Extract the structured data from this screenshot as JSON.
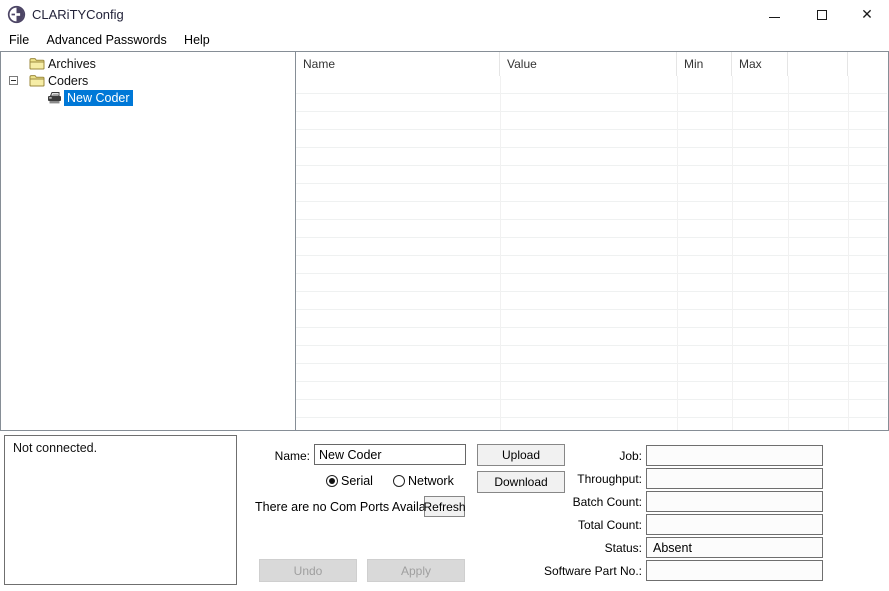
{
  "window": {
    "title": "CLARiTYConfig",
    "controls": {
      "minimize": "minimize",
      "maximize": "maximize",
      "close": "close"
    }
  },
  "icons": {
    "maximize_glyph": "",
    "close_glyph": "✕"
  },
  "menu": {
    "items": [
      {
        "label": "File"
      },
      {
        "label": "Advanced Passwords"
      },
      {
        "label": "Help"
      }
    ]
  },
  "tree": {
    "items": [
      {
        "label": "Archives",
        "icon": "folder-icon",
        "selected": false
      },
      {
        "label": "Coders",
        "icon": "folder-icon",
        "expanded": true,
        "selected": false
      },
      {
        "label": "New Coder",
        "icon": "coder-printer-icon",
        "selected": true
      }
    ]
  },
  "table": {
    "columns": [
      {
        "label": "Name"
      },
      {
        "label": "Value"
      },
      {
        "label": "Min"
      },
      {
        "label": "Max"
      },
      {
        "label": ""
      },
      {
        "label": ""
      }
    ],
    "rows": []
  },
  "console": {
    "text": "Not connected."
  },
  "form": {
    "name_label": "Name:",
    "name_value": "New Coder",
    "serial_label": "Serial",
    "network_label": "Network",
    "connection_mode": "Serial",
    "com_ports_message": "There are no Com Ports Available",
    "refresh_label": "Refresh",
    "upload_label": "Upload",
    "download_label": "Download",
    "undo_label": "Undo",
    "apply_label": "Apply"
  },
  "status_panel": {
    "rows": [
      {
        "label": "Job:",
        "value": ""
      },
      {
        "label": "Throughput:",
        "value": ""
      },
      {
        "label": "Batch Count:",
        "value": ""
      },
      {
        "label": "Total Count:",
        "value": ""
      },
      {
        "label": "Status:",
        "value": "Absent"
      },
      {
        "label": "Software Part No.:",
        "value": ""
      }
    ]
  },
  "colors": {
    "selection": "#0078d7",
    "folder_fill": "#efe48d",
    "folder_stroke": "#9c8a3e",
    "grid_line": "#eff1f1",
    "panel_border": "#868e96"
  }
}
